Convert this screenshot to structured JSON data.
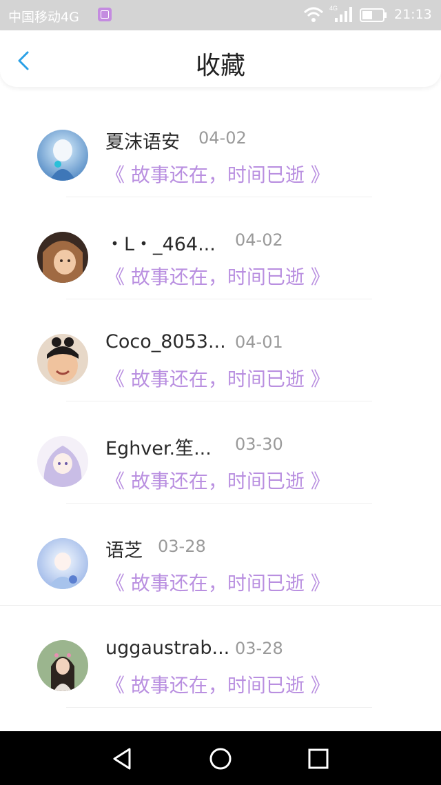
{
  "status_bar": {
    "carrier": "中国移动4G",
    "network_badge": "4G",
    "time": "21:13"
  },
  "header": {
    "title": "收藏",
    "back_icon": "chevron-left-icon"
  },
  "favorites": [
    {
      "username": "夏沫语安",
      "date": "04-02",
      "quote": "《 故事还在，时间已逝 》"
    },
    {
      "username": "・L・_464...",
      "date": "04-02",
      "quote": "《 故事还在，时间已逝 》"
    },
    {
      "username": "Coco_8053...",
      "date": "04-01",
      "quote": "《 故事还在，时间已逝 》"
    },
    {
      "username": "Eghver.笙...",
      "date": "03-30",
      "quote": "《 故事还在，时间已逝 》"
    },
    {
      "username": "语芝",
      "date": "03-28",
      "quote": "《 故事还在，时间已逝 》"
    },
    {
      "username": "uggaustrab...",
      "date": "03-28",
      "quote": "《 故事还在，时间已逝 》"
    }
  ],
  "colors": {
    "accent_back": "#2aa0e6",
    "quote": "#b98fe0",
    "status_bar_bg": "#d4d4d4"
  }
}
